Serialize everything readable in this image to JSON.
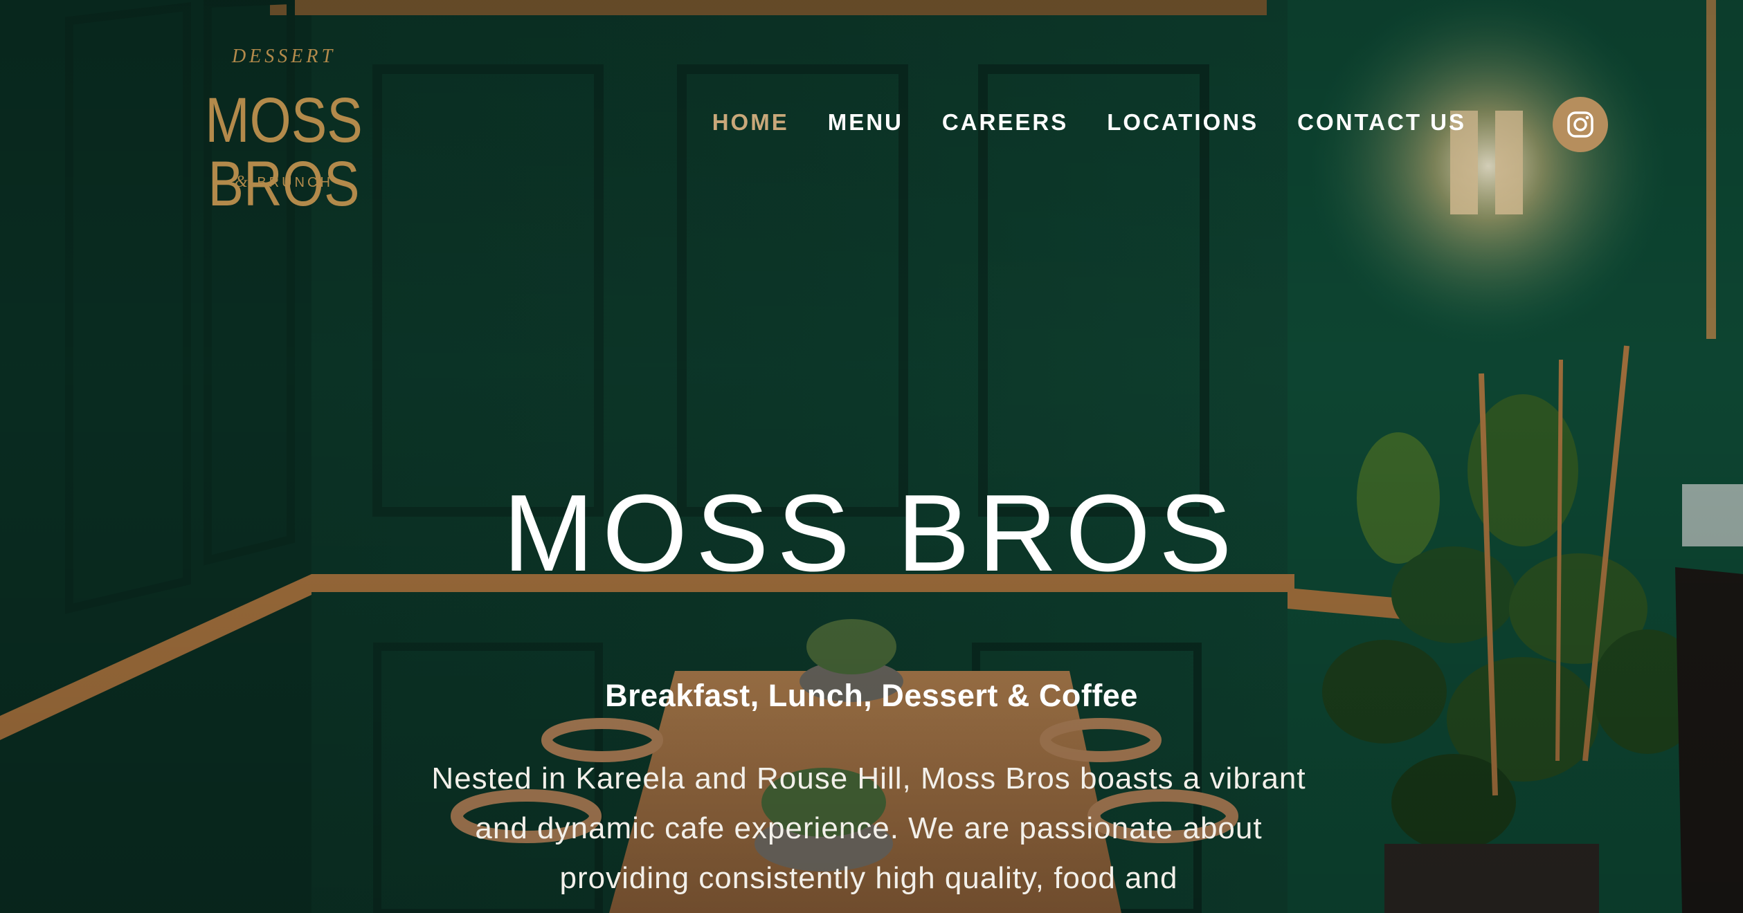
{
  "logo": {
    "top_text": "DESSERT",
    "main_text": "MOSS BROS",
    "amp": "&",
    "bottom_text": "BRUNCH"
  },
  "nav": {
    "items": [
      {
        "label": "HOME",
        "active": true
      },
      {
        "label": "MENU",
        "active": false
      },
      {
        "label": "CAREERS",
        "active": false
      },
      {
        "label": "LOCATIONS",
        "active": false
      },
      {
        "label": "CONTACT US",
        "active": false
      }
    ],
    "social_icon": "instagram-icon"
  },
  "hero": {
    "title": "MOSS BROS",
    "subtitle": "Breakfast, Lunch, Dessert & Coffee",
    "body": "Nested in Kareela and Rouse Hill, Moss Bros boasts a vibrant and dynamic cafe experience. We are passionate about providing consistently high quality, food and"
  },
  "colors": {
    "wall_green": "#0f3a2c",
    "gold": "#b38a4b",
    "nav_active": "#c9a87a",
    "instagram_bg": "#b68e5d",
    "text": "#ffffff"
  }
}
